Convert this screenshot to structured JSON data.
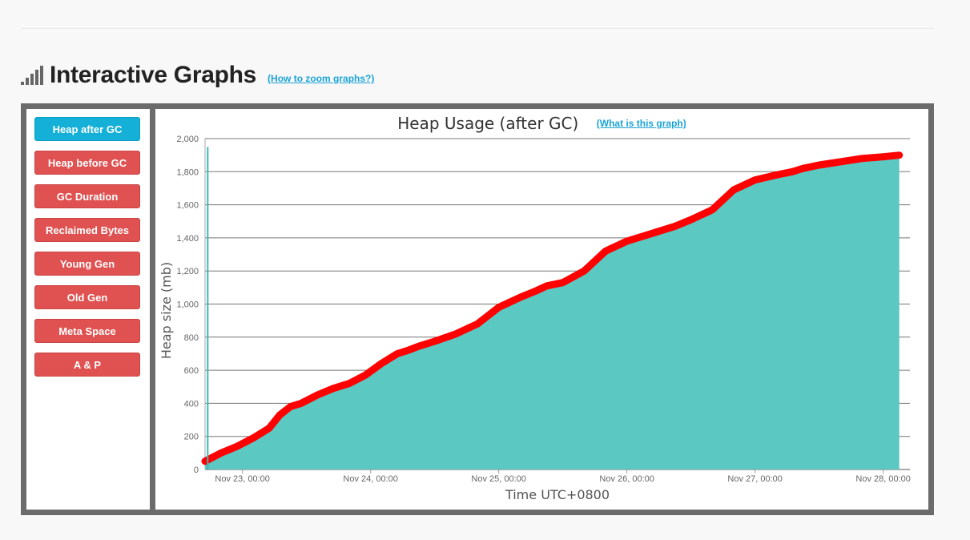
{
  "header": {
    "title": "Interactive Graphs",
    "help_link": "(How to zoom graphs?)",
    "icon": "signal-bars-icon"
  },
  "nav": {
    "items": [
      {
        "label": "Heap after GC",
        "active": true
      },
      {
        "label": "Heap before GC",
        "active": false
      },
      {
        "label": "GC Duration",
        "active": false
      },
      {
        "label": "Reclaimed Bytes",
        "active": false
      },
      {
        "label": "Young Gen",
        "active": false
      },
      {
        "label": "Old Gen",
        "active": false
      },
      {
        "label": "Meta Space",
        "active": false
      },
      {
        "label": "A & P",
        "active": false
      }
    ]
  },
  "chart": {
    "help_link": "(What is this graph)"
  },
  "colors": {
    "active_button": "#14b0d8",
    "button": "#e05252",
    "area_fill": "#5bc8c2",
    "line": "#ff0000",
    "frame": "#6b6b6b",
    "link": "#1ba3d6"
  },
  "chart_data": {
    "type": "area",
    "title": "Heap Usage (after GC)",
    "xlabel": "Time UTC+0800",
    "ylabel": "Heap size (mb)",
    "ylim": [
      0,
      2000
    ],
    "yticks": [
      0,
      200,
      400,
      600,
      800,
      1000,
      1200,
      1400,
      1600,
      1800,
      2000
    ],
    "xlim": [
      "Nov 22, 17:00",
      "Nov 28, 05:00"
    ],
    "xticks": [
      {
        "time": "Nov 23, 00:00",
        "label": "Nov 23, 00:00"
      },
      {
        "time": "Nov 24, 00:00",
        "label": "Nov 24, 00:00"
      },
      {
        "time": "Nov 25, 00:00",
        "label": "Nov 25, 00:00"
      },
      {
        "time": "Nov 26, 00:00",
        "label": "Nov 26, 00:00"
      },
      {
        "time": "Nov 27, 00:00",
        "label": "Nov 27, 00:00"
      },
      {
        "time": "Nov 28, 00:00",
        "label": "Nov 28, 00:00"
      }
    ],
    "grid": true,
    "spike": {
      "time": "Nov 22, 17:30",
      "value": 1950
    },
    "series": [
      {
        "x": [
          "Nov 22, 17:00",
          "Nov 22, 20:00",
          "Nov 22, 23:00",
          "Nov 23, 02:00",
          "Nov 23, 05:00",
          "Nov 23, 07:00",
          "Nov 23, 09:00",
          "Nov 23, 11:00",
          "Nov 23, 14:00",
          "Nov 23, 17:00",
          "Nov 23, 20:00",
          "Nov 23, 23:00",
          "Nov 24, 02:00",
          "Nov 24, 05:00",
          "Nov 24, 07:00",
          "Nov 24, 09:00",
          "Nov 24, 12:00",
          "Nov 24, 16:00",
          "Nov 24, 20:00",
          "Nov 25, 00:00",
          "Nov 25, 04:00",
          "Nov 25, 07:00",
          "Nov 25, 09:00",
          "Nov 25, 12:00",
          "Nov 25, 16:00",
          "Nov 25, 20:00",
          "Nov 26, 00:00",
          "Nov 26, 04:00",
          "Nov 26, 07:00",
          "Nov 26, 09:00",
          "Nov 26, 12:00",
          "Nov 26, 16:00",
          "Nov 26, 20:00",
          "Nov 27, 00:00",
          "Nov 27, 04:00",
          "Nov 27, 07:00",
          "Nov 27, 09:00",
          "Nov 27, 12:00",
          "Nov 27, 16:00",
          "Nov 27, 20:00",
          "Nov 28, 00:00",
          "Nov 28, 03:00"
        ],
        "values": [
          50,
          100,
          140,
          190,
          250,
          330,
          380,
          400,
          450,
          490,
          520,
          570,
          640,
          700,
          720,
          745,
          775,
          820,
          880,
          980,
          1040,
          1080,
          1110,
          1130,
          1200,
          1320,
          1380,
          1420,
          1450,
          1470,
          1510,
          1570,
          1690,
          1750,
          1780,
          1800,
          1820,
          1840,
          1860,
          1880,
          1890,
          1900
        ]
      }
    ]
  }
}
